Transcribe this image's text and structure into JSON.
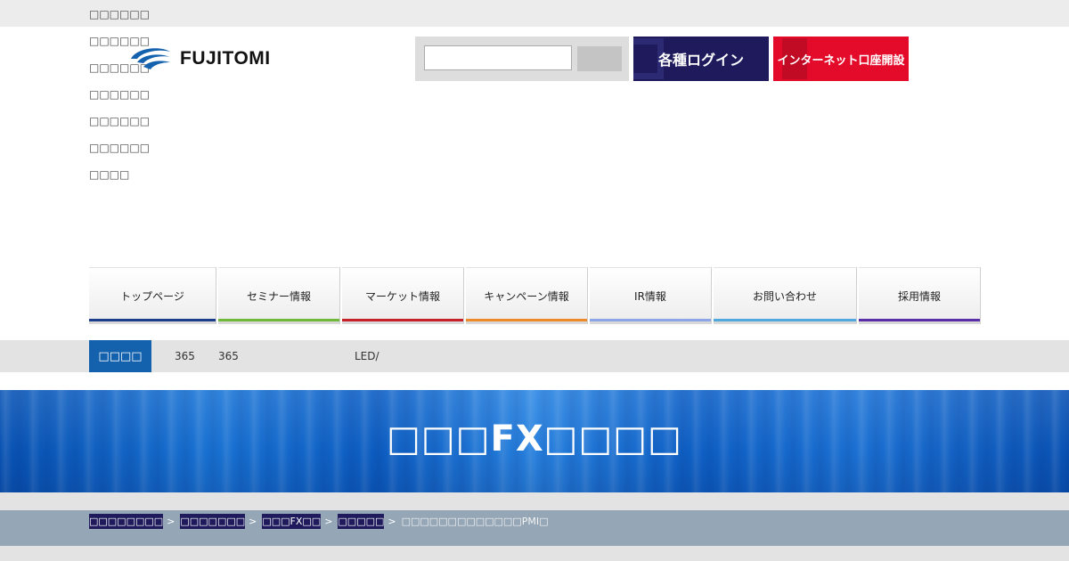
{
  "utility_links": [
    "□□□□□□",
    "□□□□□□",
    "□□□□□□",
    "□□□□□□",
    "□□□□□□",
    "□□□□□□",
    "□□□□"
  ],
  "logo": {
    "text": "FUJITOMI",
    "color": "#1461ae"
  },
  "search": {
    "value": "",
    "placeholder": "",
    "button_label": ""
  },
  "header_buttons": {
    "login_label": "各種ログイン",
    "open_account_label": "インターネット口座開設",
    "login_color": "#1e1a5c",
    "open_account_color": "#e30a2a"
  },
  "global_nav": [
    {
      "label": "トップページ",
      "color": "#1c3c8c"
    },
    {
      "label": "セミナー情報",
      "color": "#6fb83a"
    },
    {
      "label": "マーケット情報",
      "color": "#c8202a"
    },
    {
      "label": "キャンペーン情報",
      "color": "#ef8a2a"
    },
    {
      "label": "IR情報",
      "color": "#8aa6e6"
    },
    {
      "label": "お問い合わせ",
      "color": "#4fa9dd"
    },
    {
      "label": "採用情報",
      "color": "#5a2ea6"
    }
  ],
  "news": {
    "label": "□□□□",
    "item_1": "365",
    "item_2": "365",
    "item_3": "LED/"
  },
  "hero": {
    "title": "□□□FX□□□□"
  },
  "breadcrumbs": {
    "items": [
      "□□□□□□□□",
      "□□□□□□□",
      "□□□FX□□",
      "□□□□□"
    ],
    "current": "□□□□□□□□□□□□□PMI□"
  }
}
